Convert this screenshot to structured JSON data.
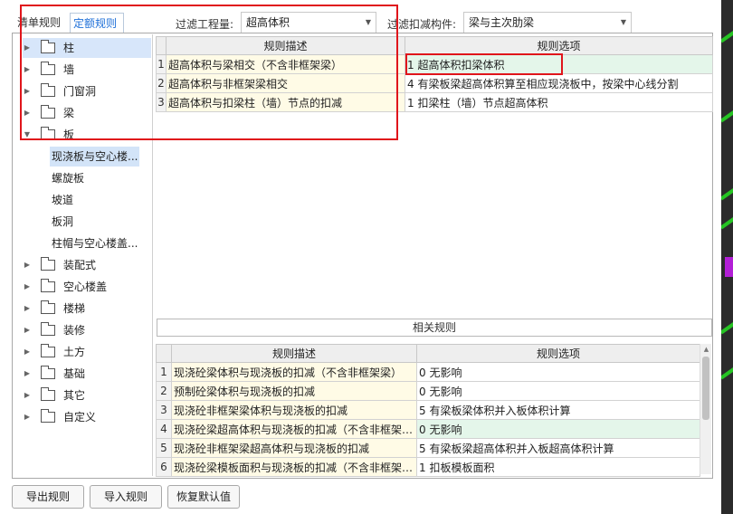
{
  "tabs": [
    {
      "label": "清单规则",
      "active": false
    },
    {
      "label": "定额规则",
      "active": true
    }
  ],
  "filters": {
    "quantity_label": "过滤工程量:",
    "quantity_value": "超高体积",
    "component_label": "过滤扣减构件:",
    "component_value": "梁与主次肋梁"
  },
  "tree": {
    "items": [
      {
        "label": "柱",
        "expanded": false,
        "selected": true
      },
      {
        "label": "墙",
        "expanded": false
      },
      {
        "label": "门窗洞",
        "expanded": false
      },
      {
        "label": "梁",
        "expanded": false
      },
      {
        "label": "板",
        "expanded": true
      },
      {
        "label": "装配式",
        "expanded": false
      },
      {
        "label": "空心楼盖",
        "expanded": false
      },
      {
        "label": "楼梯",
        "expanded": false
      },
      {
        "label": "装修",
        "expanded": false
      },
      {
        "label": "土方",
        "expanded": false
      },
      {
        "label": "基础",
        "expanded": false
      },
      {
        "label": "其它",
        "expanded": false
      },
      {
        "label": "自定义",
        "expanded": false
      }
    ],
    "children": [
      {
        "label": "现浇板与空心楼...",
        "selected": true
      },
      {
        "label": "螺旋板"
      },
      {
        "label": "坡道"
      },
      {
        "label": "板洞"
      },
      {
        "label": "柱帽与空心楼盖..."
      }
    ]
  },
  "rules_table": {
    "headers": [
      "规则描述",
      "规则选项"
    ],
    "rows": [
      {
        "no": "1",
        "desc": "超高体积与梁相交（不含非框架梁）",
        "option": "1   超高体积扣梁体积",
        "highlight": true
      },
      {
        "no": "2",
        "desc": "超高体积与非框架梁相交",
        "option": "4  有梁板梁超高体积算至相应现浇板中，按梁中心线分割"
      },
      {
        "no": "3",
        "desc": "超高体积与扣梁柱（墙）节点的扣减",
        "option": "1 扣梁柱（墙）节点超高体积"
      }
    ]
  },
  "related": {
    "title": "相关规则",
    "headers": [
      "规则描述",
      "规则选项"
    ],
    "rows": [
      {
        "no": "1",
        "desc": "现浇砼梁体积与现浇板的扣减（不含非框架梁）",
        "option": "0   无影响"
      },
      {
        "no": "2",
        "desc": "预制砼梁体积与现浇板的扣减",
        "option": "0   无影响"
      },
      {
        "no": "3",
        "desc": "现浇砼非框架梁体积与现浇板的扣减",
        "option": "5 有梁板梁体积并入板体积计算"
      },
      {
        "no": "4",
        "desc": "现浇砼梁超高体积与现浇板的扣减（不含非框架…",
        "option": "0   无影响",
        "highlight": true
      },
      {
        "no": "5",
        "desc": "现浇砼非框架梁超高体积与现浇板的扣减",
        "option": "5 有梁板梁超高体积并入板超高体积计算"
      },
      {
        "no": "6",
        "desc": "现浇砼梁模板面积与现浇板的扣减（不含非框架…",
        "option": "1 扣板模板面积"
      }
    ]
  },
  "buttons": {
    "export": "导出规则",
    "import": "导入规则",
    "reset": "恢复默认值"
  },
  "colors": {
    "accent": "#1d6fd8",
    "annotation_red": "#e0151b",
    "option_highlight": "#e4f6ea",
    "desc_bg": "#fffbe6"
  }
}
